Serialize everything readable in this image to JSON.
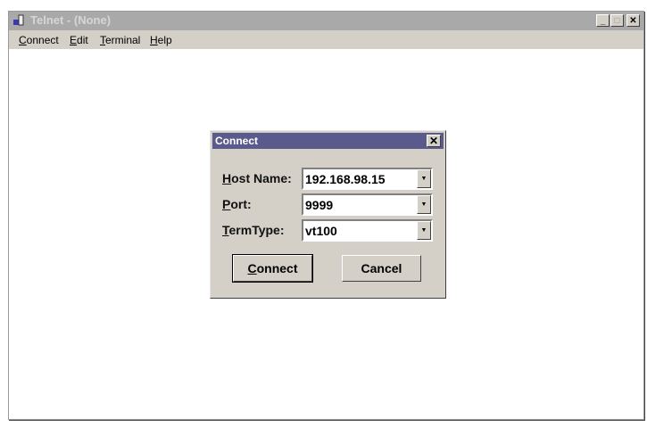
{
  "window": {
    "title": "Telnet - (None)",
    "minimize": "_",
    "maximize": "□",
    "close": "✕"
  },
  "menu": [
    {
      "mn": "C",
      "rest": "onnect"
    },
    {
      "mn": "E",
      "rest": "dit"
    },
    {
      "mn": "T",
      "rest": "erminal"
    },
    {
      "mn": "H",
      "rest": "elp"
    }
  ],
  "dialog": {
    "title": "Connect",
    "close": "✕",
    "host": {
      "mn": "H",
      "rest": "ost Name:",
      "value": "192.168.98.15"
    },
    "port": {
      "mn": "P",
      "rest": "ort:",
      "value": "9999"
    },
    "term": {
      "mn": "T",
      "rest": "ermType:",
      "value": "vt100"
    },
    "connect": {
      "mn": "C",
      "rest": "onnect"
    },
    "cancel": "Cancel",
    "arrow": "▼"
  }
}
